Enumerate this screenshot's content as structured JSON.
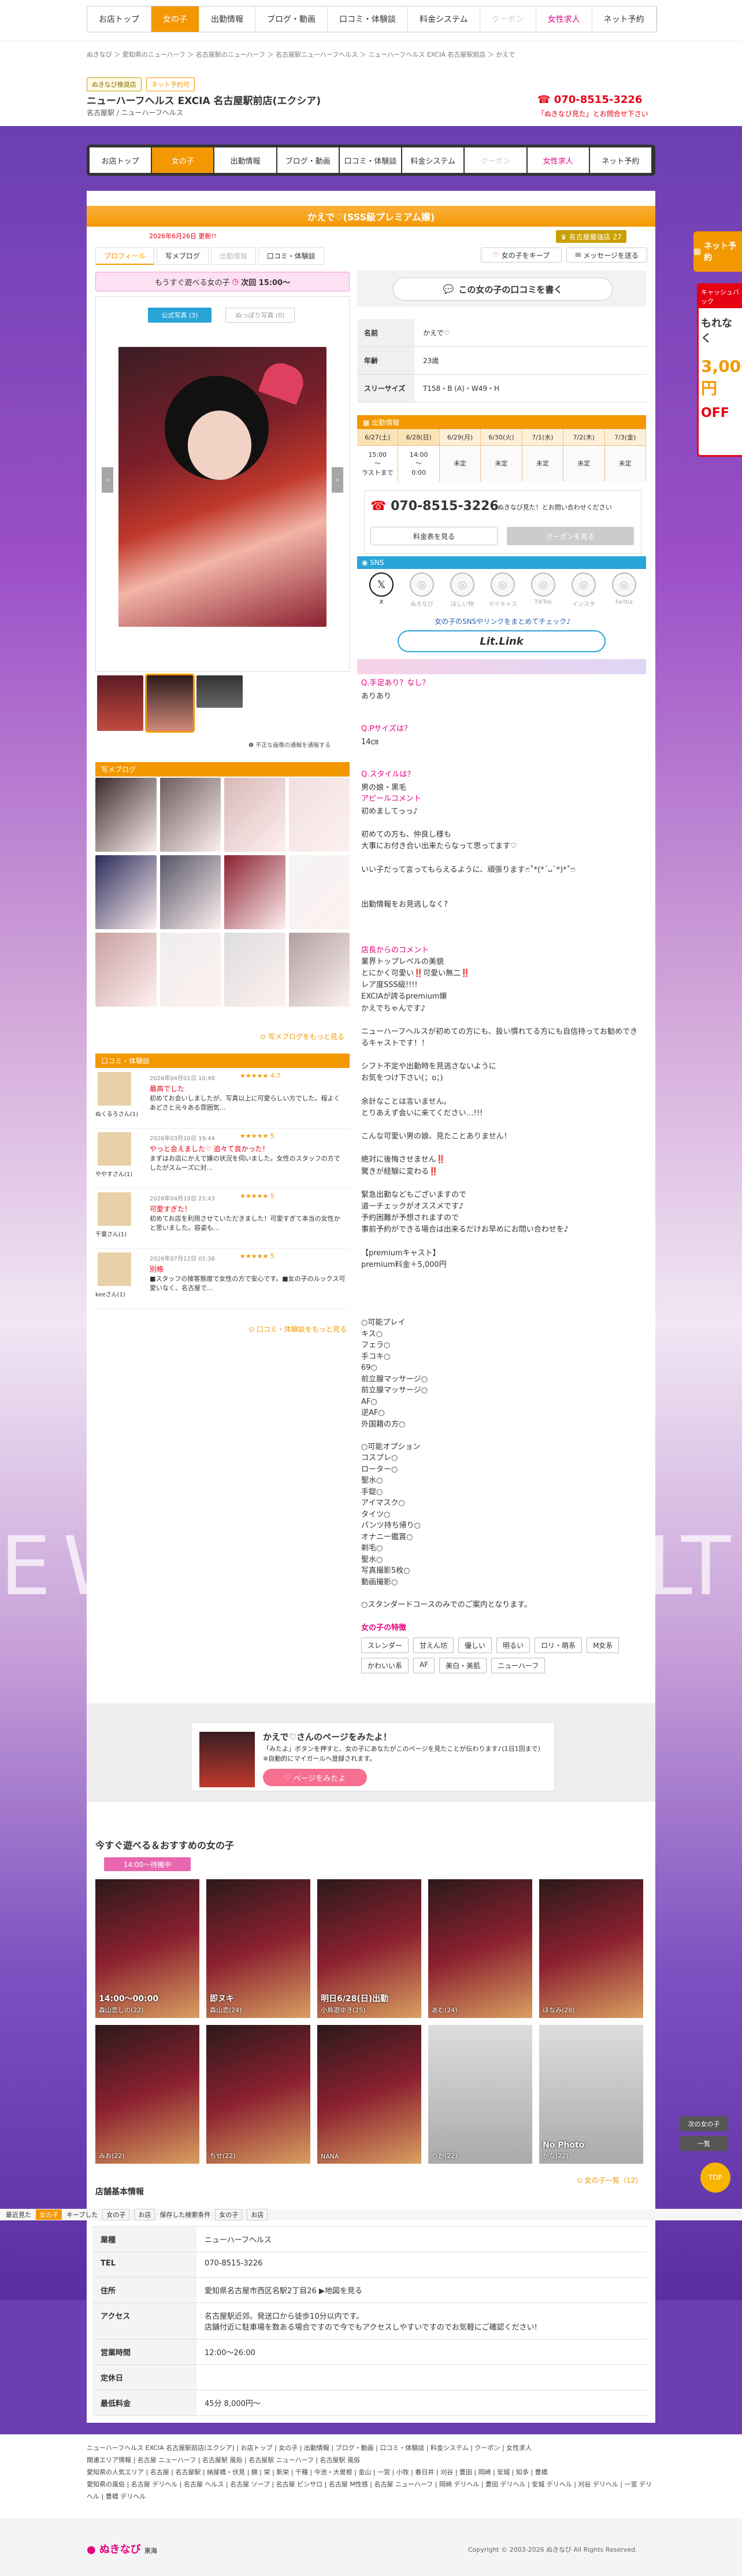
{
  "top_nav": [
    {
      "label": "お店トップ",
      "state": ""
    },
    {
      "label": "女の子",
      "state": "act"
    },
    {
      "label": "出勤情報",
      "state": ""
    },
    {
      "label": "ブログ・動画",
      "state": ""
    },
    {
      "label": "口コミ・体験談",
      "state": ""
    },
    {
      "label": "料金システム",
      "state": ""
    },
    {
      "label": "クーポン",
      "state": "dis"
    },
    {
      "label": "女性求人",
      "state": "rec"
    },
    {
      "label": "ネット予約",
      "state": ""
    }
  ],
  "breadcrumb": "ぬきなび ＞ 愛知県のニューハーフ ＞ 名古屋駅のニューハーフ ＞ 名古屋駅ニューハーフヘルス ＞ ニューハーフヘルス EXCIA 名古屋駅前店 ＞ かえで",
  "shop": {
    "badge1": "ぬきなび推奨店",
    "badge2": "ネット予約可",
    "name": "ニューハーフヘルス EXCIA 名古屋駅前店(エクシア)",
    "area": "名古屋駅 / ニューハーフヘルス",
    "tel": "070-8515-3226",
    "tel_note": "「ぬきなび見た」とお問合せ下さい"
  },
  "girl": {
    "title": "かえで♡(SSS級プレミアム嬢)",
    "update": "2026年6月26日 更新!!",
    "rank_label": "名古屋最強店",
    "rank_num": "27",
    "fav_btn": "女の子をキープ",
    "msg_btn": "メッセージを送る",
    "tabs": [
      "プロフィール",
      "写メブログ",
      "出勤情報",
      "口コミ・体験談"
    ],
    "next_play": "もうすぐ遊べる女の子",
    "next_time": "次回 15:00〜",
    "photo_tab_official": "公式写真 (3)",
    "photo_tab_user": "ぬっぽり写真 (0)",
    "photo_note": "不正な画像の通報を通報する",
    "review_btn": "この女の子の口コミを書く",
    "profile": [
      {
        "k": "名前",
        "v": "かえで♡"
      },
      {
        "k": "年齢",
        "v": "23歳"
      },
      {
        "k": "スリーサイズ",
        "v": "T158・B (A)・W49・H"
      }
    ],
    "schedule_head": "出勤情報",
    "schedule": [
      {
        "d": "6/27(土)",
        "t": "15:00\n〜\nラストまで",
        "hl": true
      },
      {
        "d": "6/28(日)",
        "t": "14:00\n〜\n0:00",
        "hl": true
      },
      {
        "d": "6/29(月)",
        "t": "未定"
      },
      {
        "d": "6/30(火)",
        "t": "未定"
      },
      {
        "d": "7/1(水)",
        "t": "未定"
      },
      {
        "d": "7/2(木)",
        "t": "未定"
      },
      {
        "d": "7/3(金)",
        "t": "未定"
      }
    ],
    "tel": "070-8515-3226",
    "tel_note": "ぬきなび見た！とお問い合わせください",
    "sched_btn": "料金表を見る",
    "coupon_btn": "クーポンを見る",
    "sns_head": "SNS",
    "sns": [
      {
        "name": "X",
        "icon": "x-icon",
        "color": "#111"
      },
      {
        "name": "ぬきなび",
        "icon": "nukinavi-icon",
        "color": "#bbb"
      },
      {
        "name": "ほしい物",
        "icon": "amazon-icon",
        "color": "#bbb"
      },
      {
        "name": "マイキャス",
        "icon": "mycas-icon",
        "color": "#bbb"
      },
      {
        "name": "TikTok",
        "icon": "tiktok-icon",
        "color": "#bbb"
      },
      {
        "name": "インスタ",
        "icon": "instagram-icon",
        "color": "#bbb"
      },
      {
        "name": "Fantia",
        "icon": "fantia-icon",
        "color": "#bbb"
      }
    ],
    "sns_link_note": "女の子のSNSやリンクをまとめてチェック♪",
    "litlink": "Lit.Link",
    "qa": [
      {
        "q": "Q.手足あり？なし？",
        "a": "ありあり"
      },
      {
        "q": "Q.Pサイズは？",
        "a": "14㎝"
      },
      {
        "q": "Q.スタイルは？",
        "a": "男の娘・黒毛"
      }
    ],
    "appeal_head": "アピールコメント",
    "appeal": "初めましてっっ♪\n\n初めての方も、仲良し様も\n大事にお付き合い出来たらなって思ってます♡\n\nいい子だって言ってもらえるように、頑張りますෆ˚*(*´ᴗ`*)*˚ෆ\n\n\n出勤情報をお見逃しなく?",
    "shop_comment_head": "店長からのコメント",
    "shop_comment": "業界トップレベルの美貌\nとにかく可愛い‼️可愛い無二‼️\nレア度SSS級!!!!\nEXCIAが誇るpremium嬢\nかえでちゃんです♪\n\nニューハーフヘルスが初めての方にも、扱い慣れてる方にも自信持ってお勧めできるキャストです！！\n\nシフト不定や出勤時を見逃さないように\nお気をつけ下さい(；o；)\n\n余計なことは言いません。\nとりあえず会いに来てください…!!!\n\nこんな可愛い男の娘、見たことありません！\n\n絶対に後悔させません‼️\n驚きが経験に変わる‼️\n\n緊急出勤などもございますので\n道一チェックがオススメです♪\n予約困難が予想されますので\n事前予約ができる場合は出来るだけお早めにお問い合わせを♪\n\n【premiumキャスト】\npremium料金＋5,000円",
    "options": "○可能プレイ\nキス○\nフェラ○\n手コキ○\n69○\n前立腺マッサージ○\n前立腺マッサージ○\nAF○\n逆AF○\n外国籍の方○\n\n○可能オプション\nコスプレ○\nローター○\n聖水○\n手錠○\nアイマスク○\nタイツ○\nパンツ持ち帰り○\nオナニー鑑賞○\n剃毛○\n聖水○\n写真撮影5枚○\n動画撮影○\n\n○スタンダードコースのみでのご案内となります。",
    "traits_head": "女の子の特徴",
    "traits": [
      "スレンダー",
      "甘えん坊",
      "優しい",
      "明るい",
      "ロリ・萌系",
      "M女系",
      "かわいい系",
      "AF",
      "美白・美肌",
      "ニューハーフ"
    ],
    "blog_head": "写メブログ",
    "blog_more": "写メブログをもっと見る",
    "reviews_head": "口コミ・体験談",
    "reviews": [
      {
        "user": "ぬくるろさん(1)",
        "date": "2026年04月01日 10:48",
        "stars": "★★★★★ 4.7",
        "title": "最高でした",
        "body": "初めてお会いしましたが、写真以上に可愛らしい方でした。程よくあどさと元々ある雰囲気..."
      },
      {
        "user": "ややすさん(1)",
        "date": "2026年03月10日 19:44",
        "stars": "★★★★★ 5",
        "title": "やっと会えました♡ 追々て良かった！",
        "body": "まずはお店にかえで嬢の状況を伺いました。女性のスタッフの方でしたがスムーズに対..."
      },
      {
        "user": "千葉さん(1)",
        "date": "2026年04月19日 21:43",
        "stars": "★★★★★ 5",
        "title": "可愛すぎた！",
        "body": "初めてお店を利用させていただきました！可愛すぎて本当の女性かと思いました。容姿も..."
      },
      {
        "user": "keeさん(1)",
        "date": "2026年07月12日 01:36",
        "stars": "★★★★★ 5",
        "title": "別格",
        "body": "■スタッフの接客態度で女性の方で安心です。■女の子のルックス可愛いなく、名古屋で..."
      }
    ],
    "reviews_more": "口コミ・体験談をもっと見る"
  },
  "promo": {
    "title": "かえで♡さんのページをみたよ！",
    "body": "「みたよ」ボタンを押すと、女の子にあなたがこのページを見たことが伝わります♪(1日1回まで) ※自動的にマイガールへ登録されます。",
    "btn": "ページをみたよ"
  },
  "recommend": {
    "title": "今すぐ遊べる＆おすすめの女の子",
    "badge": "14:00〜待機中",
    "more": "女の子一覧（12）",
    "items": [
      {
        "cap": "14:00〜00:00",
        "sub": "森山恋しの(22)",
        "dark": true
      },
      {
        "cap": "即ヌキ",
        "sub": "森山恋(24)",
        "dark": true
      },
      {
        "cap": "明日6/28(日)出勤",
        "sub": "小鳥遊ゆき(25)",
        "dark": true
      },
      {
        "cap": "",
        "sub": "あむ(24)",
        "dark": true
      },
      {
        "cap": "",
        "sub": "ほなみ(28)",
        "dark": true
      },
      {
        "cap": "",
        "sub": "みお(22)",
        "dark": true
      },
      {
        "cap": "",
        "sub": "ちせ(22)",
        "dark": true
      },
      {
        "cap": "",
        "sub": "NANA",
        "dark": true
      },
      {
        "cap": "",
        "sub": "りか(22)",
        "dark": false
      },
      {
        "cap": "No Photo",
        "sub": "かな(22)",
        "dark": false
      }
    ]
  },
  "shop_info": {
    "title": "店舗基本情報",
    "rows": [
      {
        "k": "業種",
        "v": "ニューハーフヘルス"
      },
      {
        "k": "TEL",
        "v": "070-8515-3226"
      },
      {
        "k": "住所",
        "v": "愛知県名古屋市西区名駅2丁目26 ▶地図を見る"
      },
      {
        "k": "アクセス",
        "v": "名古屋駅近郊。発送口から徒歩10分以内です。\n店舗付近に駐車場を数ある場合ですので今でもアクセスしやすいですのでお気軽にご確認ください!"
      },
      {
        "k": "営業時間",
        "v": "12:00〜26:00"
      },
      {
        "k": "定休日",
        "v": ""
      },
      {
        "k": "最低料金",
        "v": "45分 8,000円〜"
      }
    ]
  },
  "bottom_bar": {
    "label1": "最近見た",
    "chip1": "女の子",
    "label2": "キープした",
    "chip2": "女の子",
    "chip3": "お店",
    "label3": "保存した検索条件",
    "chip4": "女の子",
    "chip5": "お店"
  },
  "side": {
    "next": "ネット予約",
    "campaign": "キャッシュバック",
    "cashback": "もれなく",
    "amount": "3,000円",
    "amount_note": "OFF",
    "girl_list": "次の女の子",
    "list": "一覧",
    "top": "TOP"
  },
  "footer": {
    "shop_line": "ニューハーフヘルス EXCIA 名古屋駅前店(エクシア) | お店トップ | 女の子 | 出勤情報 | ブログ・動画 | 口コミ・体験談 | 料金システム | クーポン | 女性求人",
    "line2": "関連エリア情報 | 名古屋 ニューハーフ | 名古屋駅 風俗 | 名古屋駅 ニューハーフ | 名古屋駅 風俗",
    "line3": "愛知県の人気エリア | 名古屋 | 名古屋駅 | 納屋橋・伏見 | 錦 | 栄 | 新栄 | 千種 | 今池・大曽根 | 金山 | 一宮 | 小牧 | 春日井 | 刈谷 | 豊田 | 岡崎 | 安城 | 知多 | 豊橋",
    "line4": "愛知県の風俗 | 名古屋 デリヘル | 名古屋 ヘルス | 名古屋 ソープ | 名古屋 ピンサロ | 名古屋 M性感 | 名古屋 ニューハーフ | 岡崎 デリヘル | 豊田 デリヘル | 安城 デリヘル | 刈谷 デリヘル | 一宮 デリヘル | 豊橋 デリヘル",
    "logo": "ぬきなび",
    "logo_area": "東海",
    "copyright": "Copyright © 2003-2026 ぬきなび All Rights Reserved."
  }
}
